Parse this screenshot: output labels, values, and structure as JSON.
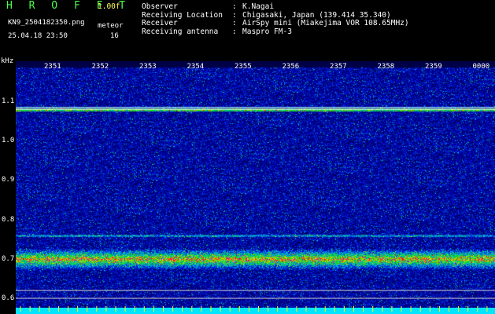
{
  "header": {
    "brand": "H R O F F T",
    "version": "1.00f",
    "filename": "KN9_2504182350.png",
    "datetime": "25.04.18 23:50",
    "meteor_label": "meteor",
    "meteor_count": "16"
  },
  "info": [
    {
      "key": "Observer",
      "value": "K.Nagai"
    },
    {
      "key": "Receiving Location",
      "value": "Chigasaki, Japan (139.414 35.340)"
    },
    {
      "key": "Receiver",
      "value": "AirSpy mini (Miakejima VOR 108.65MHz)"
    },
    {
      "key": "Receiving antenna",
      "value": "Maspro FM-3"
    }
  ],
  "axis": {
    "unit": "kHz",
    "y_labels": [
      "1.1",
      "1.0",
      "0.9",
      "0.8",
      "0.7",
      "0.6"
    ],
    "y_values": [
      1.1,
      1.0,
      0.9,
      0.8,
      0.7,
      0.6
    ],
    "time_labels": [
      "2351",
      "2352",
      "2353",
      "2354",
      "2355",
      "2356",
      "2357",
      "2358",
      "2359",
      "0000"
    ]
  },
  "colors": {
    "background": "#000000",
    "brand": "#4cff4c",
    "version": "#ffff55",
    "text": "#ffffff",
    "tick": "#ffff00",
    "bottom_band": "#00e5ff"
  }
}
